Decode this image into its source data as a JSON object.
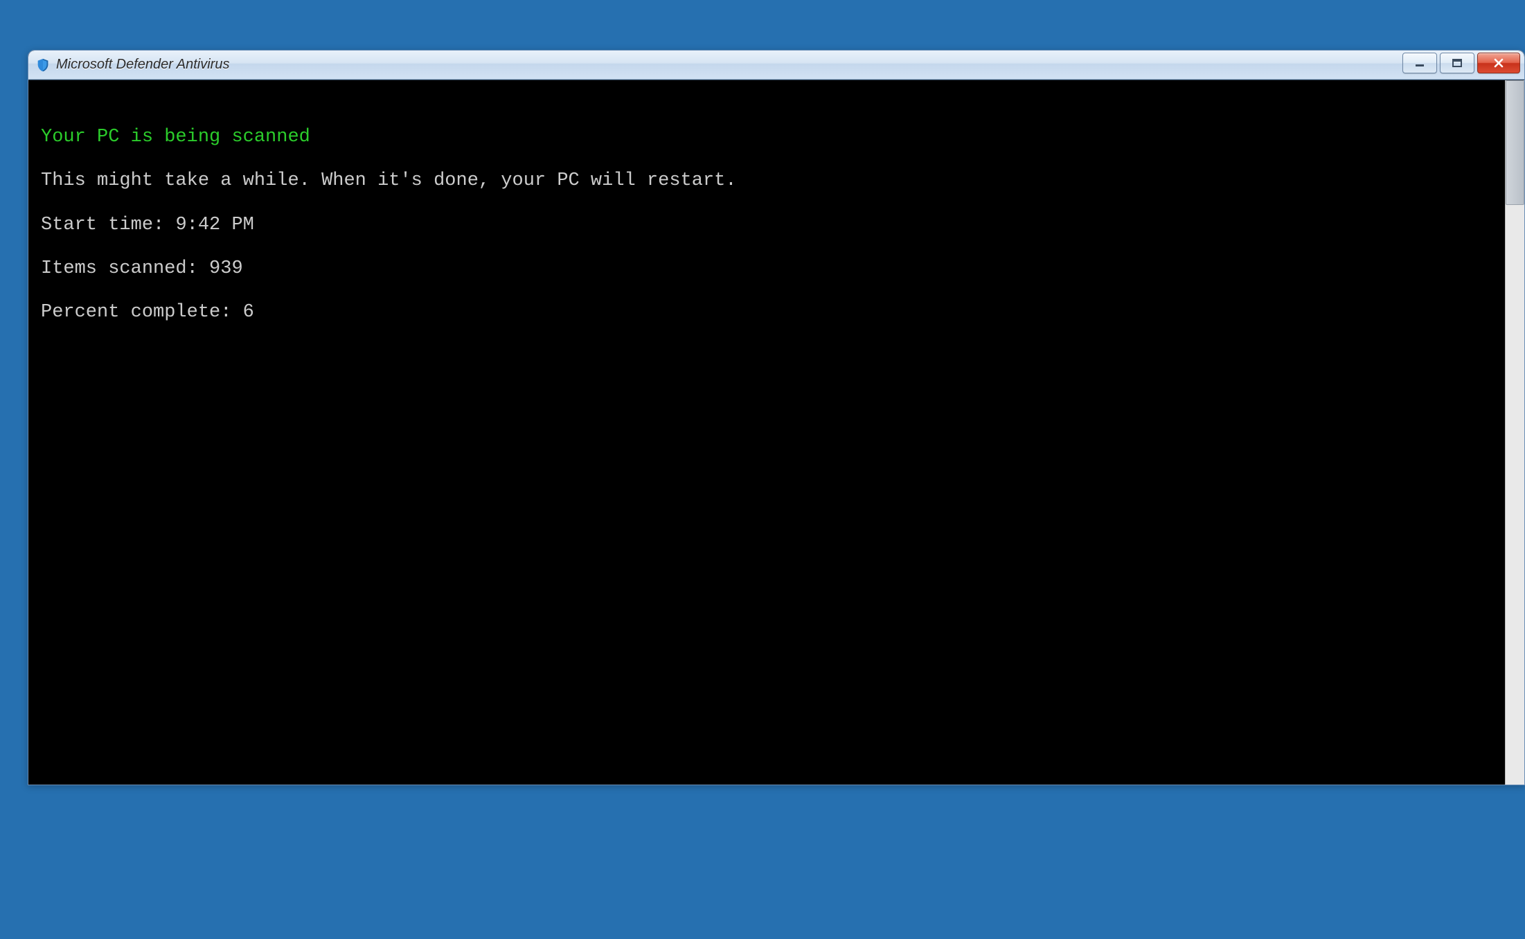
{
  "window": {
    "title": "Microsoft Defender Antivirus"
  },
  "console": {
    "heading": "Your PC is being scanned",
    "message": "This might take a while. When it's done, your PC will restart.",
    "start_time_label": "Start time: ",
    "start_time_value": "9:42 PM",
    "items_scanned_label": "Items scanned: ",
    "items_scanned_value": "939",
    "percent_complete_label": "Percent complete: ",
    "percent_complete_value": "6"
  }
}
